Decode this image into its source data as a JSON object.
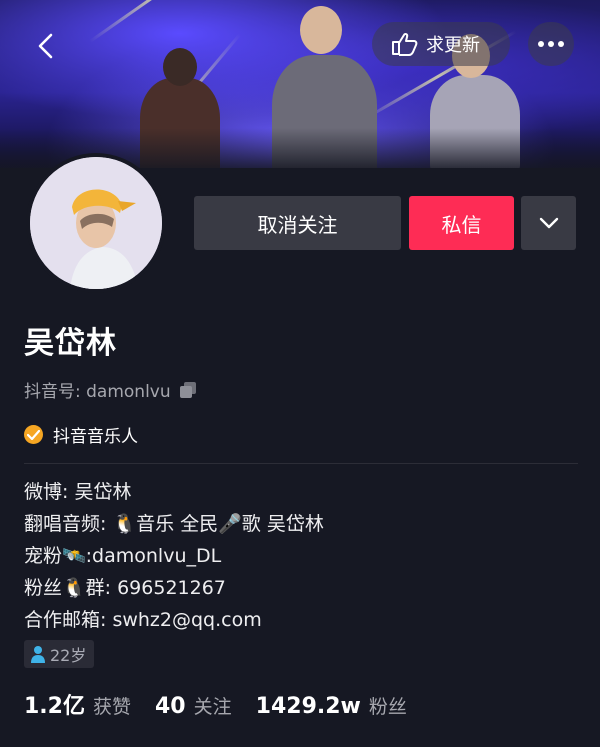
{
  "colors": {
    "background": "#161823",
    "accent_red": "#fe2c55",
    "button_gray": "#393a44",
    "muted_text": "#a6a7ae",
    "verify_orange": "#f6a623",
    "age_icon_blue": "#3fb3e8"
  },
  "header": {
    "back_icon": "chevron-left-icon",
    "update_button": {
      "icon": "hand-pointing-icon",
      "label": "求更新"
    },
    "more_icon": "more-dots-icon"
  },
  "actions": {
    "unfollow_label": "取消关注",
    "message_label": "私信",
    "dropdown_icon": "chevron-down-icon"
  },
  "profile": {
    "name": "吴岱林",
    "douyin_id_label": "抖音号: damonlvu",
    "copy_icon": "copy-icon",
    "verification": {
      "icon": "checkmark-badge-icon",
      "label": "抖音音乐人"
    },
    "bio": [
      "微博: 吴岱林",
      "翻唱音频: 🐧音乐 全民🎤歌 吴岱林",
      "宠粉🛰️:damonlvu_DL",
      "粉丝🐧群: 696521267",
      "合作邮箱: swhz2@qq.com"
    ],
    "age_tag": {
      "icon": "person-icon",
      "label": "22岁"
    }
  },
  "stats": [
    {
      "value": "1.2亿",
      "label": "获赞"
    },
    {
      "value": "40",
      "label": "关注"
    },
    {
      "value": "1429.2w",
      "label": "粉丝"
    }
  ]
}
